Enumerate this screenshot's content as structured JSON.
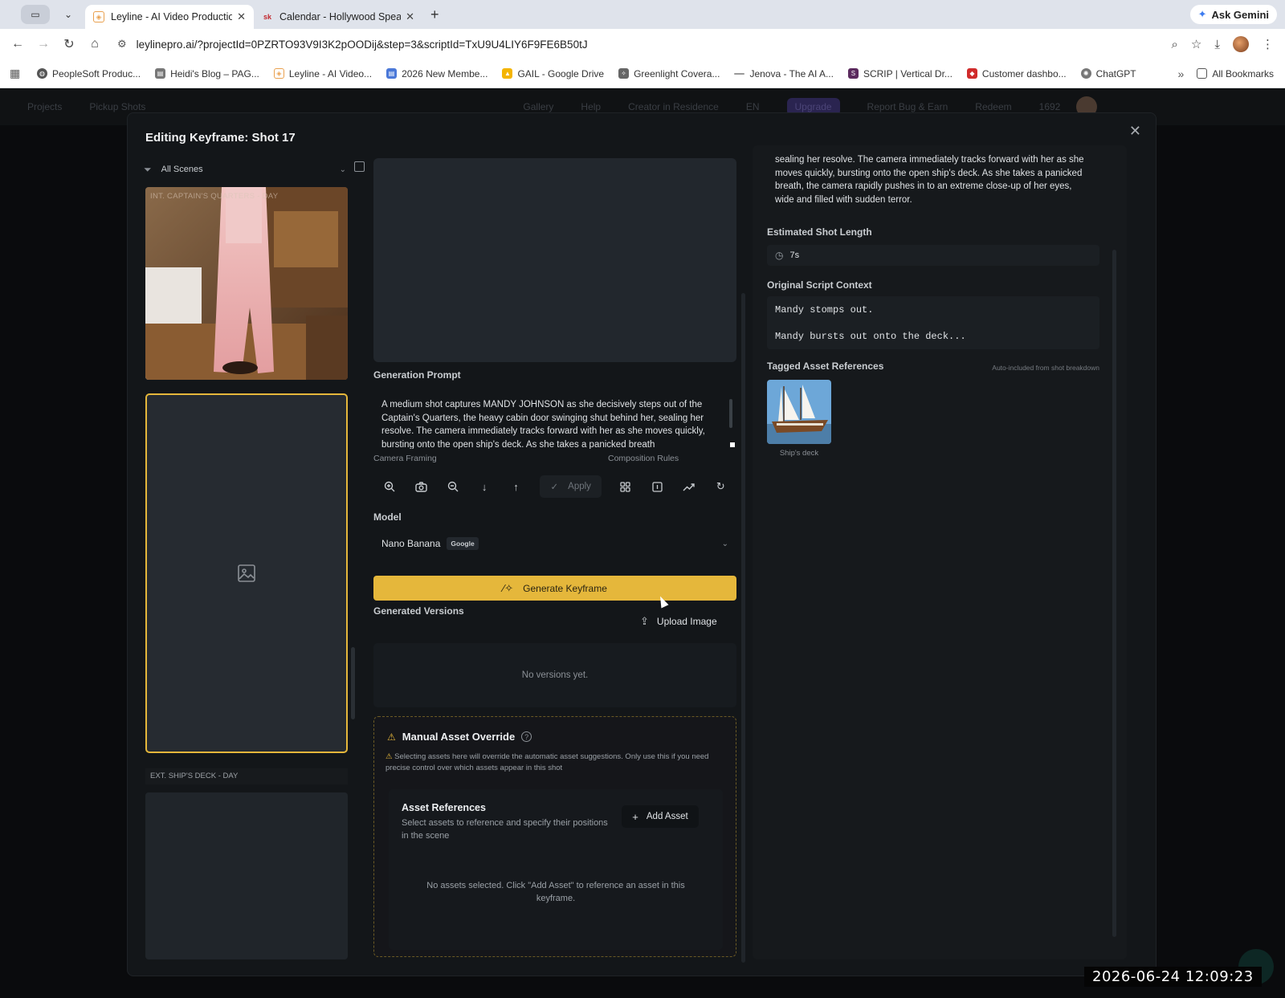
{
  "browser": {
    "tabs": [
      {
        "title": "Leyline - AI Video Production",
        "active": true
      },
      {
        "title": "Calendar - Hollywood Speakers",
        "active": false
      }
    ],
    "gemini_label": "Ask Gemini",
    "url": "leylinepro.ai/?projectId=0PZRTO93V9I3K2pOODij&step=3&scriptId=TxU9U4LIY6F9FE6B50tJ",
    "bookmarks": [
      "PeopleSoft Produc...",
      "Heidi's Blog – PAG...",
      "Leyline - AI Video...",
      "2026 New Membe...",
      "GAIL - Google Drive",
      "Greenlight Covera...",
      "Jenova - The AI A...",
      "SCRIP | Vertical Dr...",
      "Customer dashbo...",
      "ChatGPT"
    ],
    "all_bookmarks": "All Bookmarks"
  },
  "appbar": {
    "projects": "Projects",
    "pickup": "Pickup Shots",
    "gallery": "Gallery",
    "help": "Help",
    "creator": "Creator in Residence",
    "lang": "EN",
    "upgrade": "Upgrade",
    "report": "Report Bug & Earn",
    "redeem": "Redeem",
    "credits": "1692"
  },
  "modal": {
    "title": "Editing Keyframe: Shot 17",
    "scene_filter": "All Scenes",
    "scene1_label": "INT. CAPTAIN'S QUARTERS - DAY",
    "scene2_label": "EXT. SHIP'S DECK - DAY",
    "generation_prompt_label": "Generation Prompt",
    "generation_prompt": "A medium shot captures MANDY JOHNSON as she decisively steps out of the Captain's Quarters, the heavy cabin door swinging shut behind her, sealing her resolve. The camera immediately tracks forward with her as she moves quickly, bursting onto the open ship's deck. As she takes a panicked breath",
    "camera_framing_label": "Camera Framing",
    "composition_rules_label": "Composition Rules",
    "apply_label": "Apply",
    "model_label": "Model",
    "model_name": "Nano Banana",
    "model_provider": "Google",
    "generate_label": "Generate Keyframe",
    "generated_versions_label": "Generated Versions",
    "upload_label": "Upload Image",
    "no_versions": "No versions yet.",
    "override_title": "Manual Asset Override",
    "override_note": "Selecting assets here will override the automatic asset suggestions. Only use this if you need precise control over which assets appear in this shot",
    "asset_refs_title": "Asset References",
    "asset_refs_sub": "Select assets to reference and specify their positions in the scene",
    "add_asset_label": "Add Asset",
    "no_assets": "No assets selected. Click \"Add Asset\" to reference an asset in this keyframe."
  },
  "right": {
    "description": "sealing her resolve. The camera immediately tracks forward with her as she moves quickly, bursting onto the open ship's deck. As she takes a panicked breath, the camera rapidly pushes in to an extreme close-up of her eyes, wide and filled with sudden terror.",
    "shot_length_label": "Estimated Shot Length",
    "shot_length": "7s",
    "script_context_label": "Original Script Context",
    "script_lines": [
      "Mandy stomps out.",
      "Mandy bursts out onto the deck..."
    ],
    "tagged_assets_label": "Tagged Asset References",
    "auto_note": "Auto-included from shot breakdown",
    "asset_caption": "Ship's deck"
  },
  "overlay": {
    "timestamp": "2026-06-24 12:09:23"
  },
  "colors": {
    "accent": "#e5b73b",
    "modal_bg": "#131619",
    "panel_bg": "#16191c"
  }
}
